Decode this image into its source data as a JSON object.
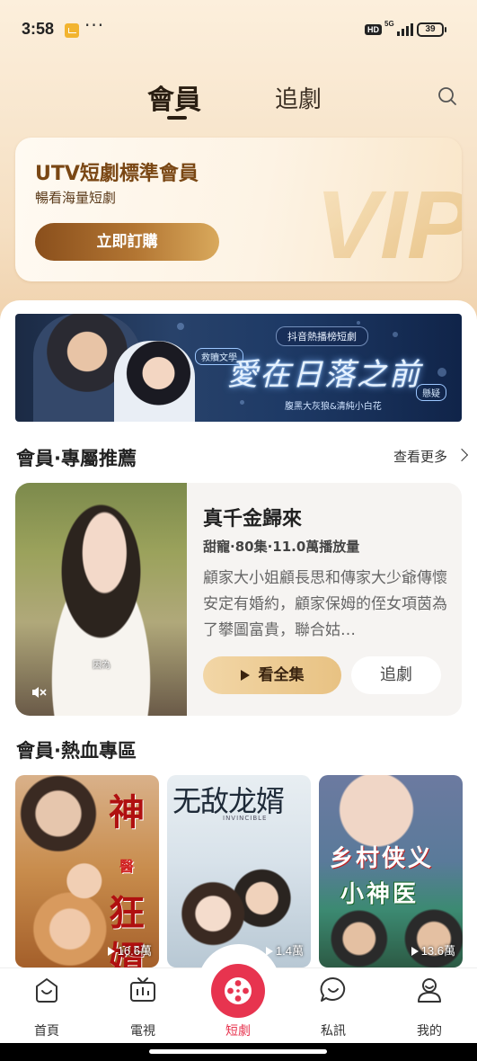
{
  "status_bar": {
    "time": "3:58",
    "dots": "···",
    "hd": "HD",
    "network": "5G",
    "battery": "39"
  },
  "header": {
    "tab_member": "會員",
    "tab_follow": "追劇"
  },
  "vip_card": {
    "title": "UTV短劇標準會員",
    "subtitle": "暢看海量短劇",
    "button": "立即訂購",
    "logo": "VIP"
  },
  "banner": {
    "tag": "抖音熱播榜短劇",
    "badge_left": "救贖文學",
    "title": "愛在日落之前",
    "badge_right": "懸疑",
    "subtitle": "腹黑大灰狼&清純小白花"
  },
  "section_exclusive": {
    "title": "會員·專屬推薦",
    "see_more": "查看更多"
  },
  "featured": {
    "poster_caption": "因為",
    "title": "真千金歸來",
    "meta": "甜寵·80集·11.0萬播放量",
    "description": "顧家大小姐顧長思和傳家大少爺傳懷安定有婚約，顧家保姆的侄女項茵為了攀圖富貴，聯合姑…",
    "watch_button": "看全集",
    "follow_button": "追劇"
  },
  "section_hot": {
    "title": "會員·熱血專區"
  },
  "grid": [
    {
      "title_top": "神",
      "title_small": "醫",
      "title_mid": "狂",
      "title_bottom": "婿",
      "plays": "16.6萬"
    },
    {
      "title": "无敌龙婿",
      "subtitle_en": "INVINCIBLE",
      "plays": "1.4萬"
    },
    {
      "title_line1": "乡村侠义",
      "title_line2": "小神医",
      "plays": "13.6萬"
    }
  ],
  "bottom_nav": {
    "home": "首頁",
    "tv": "電視",
    "short": "短劇",
    "messages": "私訊",
    "me": "我的"
  },
  "colors": {
    "accent_red": "#e7344f",
    "vip_gold": "#7a4714",
    "header_bg": "#f6e7d2"
  }
}
